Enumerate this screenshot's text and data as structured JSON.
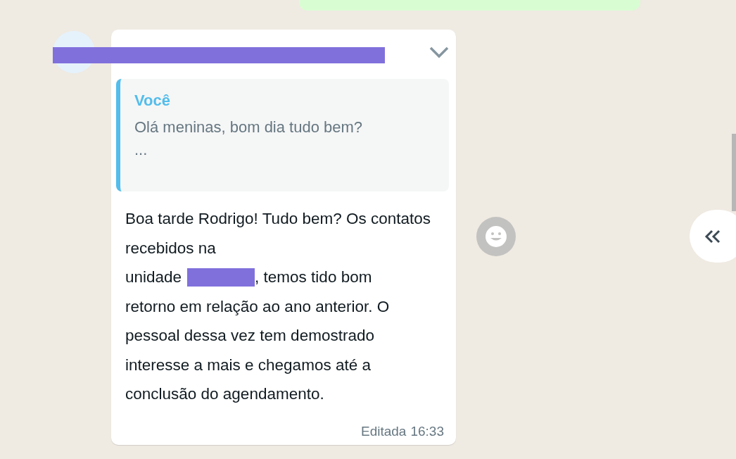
{
  "message": {
    "quote": {
      "author": "Você",
      "text": "Olá meninas, bom dia tudo bem?",
      "more": "..."
    },
    "text_parts": [
      "Boa tarde Rodrigo! Tudo bem? Os contatos recebidos na",
      "unidade",
      ", temos tido bom",
      "retorno em relação ao ano anterior. O pessoal dessa vez tem demostrado interesse a mais e chegamos até a conclusão do agendamento."
    ],
    "edited_label": "Editada",
    "time": "16:33"
  }
}
